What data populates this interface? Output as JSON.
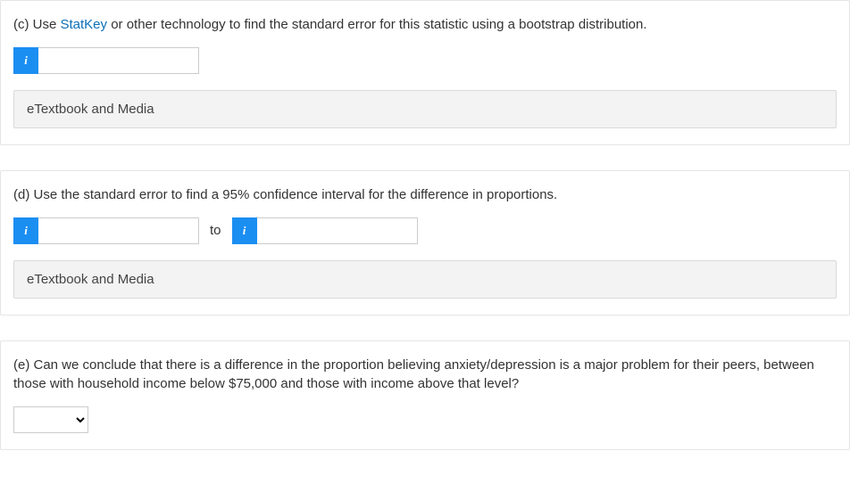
{
  "questions": {
    "c": {
      "prefix": "(c) Use ",
      "link": "StatKey",
      "suffix": " or other technology to find the standard error for this statistic using a bootstrap distribution.",
      "info_glyph": "i",
      "input_value": "",
      "media_label": "eTextbook and Media"
    },
    "d": {
      "text": "(d) Use the standard error to find a 95% confidence interval for the difference in proportions.",
      "info_glyph": "i",
      "input1_value": "",
      "sep": "to",
      "input2_value": "",
      "media_label": "eTextbook and Media"
    },
    "e": {
      "text": "(e) Can we conclude that there is a difference in the proportion believing anxiety/depression is a major problem for their peers, between those with household income below $75,000 and those with income above that level?",
      "select_value": ""
    }
  }
}
